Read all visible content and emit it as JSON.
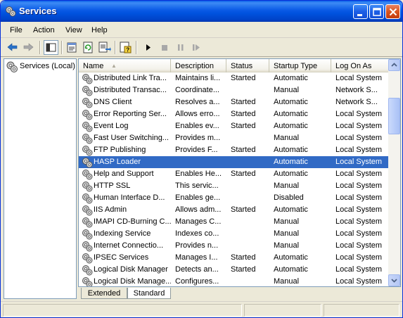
{
  "window": {
    "title": "Services",
    "buttons": [
      "minimize",
      "maximize",
      "close"
    ]
  },
  "menu": {
    "items": [
      "File",
      "Action",
      "View",
      "Help"
    ]
  },
  "toolbar": {
    "icons": [
      "back-arrow-icon",
      "forward-arrow-icon",
      "show-hide-tree-icon",
      "properties-icon",
      "refresh-icon",
      "export-list-icon",
      "help-icon",
      "start-service-icon",
      "stop-service-icon",
      "pause-service-icon",
      "restart-service-icon"
    ]
  },
  "tree": {
    "root_label": "Services (Local)"
  },
  "list": {
    "columns": [
      "Name",
      "Description",
      "Status",
      "Startup Type",
      "Log On As"
    ],
    "sorted_column": "Name",
    "selected_row": "HASP Loader",
    "rows": [
      {
        "name": "Distributed Link Tra...",
        "description": "Maintains li...",
        "status": "Started",
        "startup": "Automatic",
        "logon": "Local System"
      },
      {
        "name": "Distributed Transac...",
        "description": "Coordinate...",
        "status": "",
        "startup": "Manual",
        "logon": "Network S..."
      },
      {
        "name": "DNS Client",
        "description": "Resolves a...",
        "status": "Started",
        "startup": "Automatic",
        "logon": "Network S..."
      },
      {
        "name": "Error Reporting Ser...",
        "description": "Allows erro...",
        "status": "Started",
        "startup": "Automatic",
        "logon": "Local System"
      },
      {
        "name": "Event Log",
        "description": "Enables ev...",
        "status": "Started",
        "startup": "Automatic",
        "logon": "Local System"
      },
      {
        "name": "Fast User Switching...",
        "description": "Provides m...",
        "status": "",
        "startup": "Manual",
        "logon": "Local System"
      },
      {
        "name": "FTP Publishing",
        "description": "Provides F...",
        "status": "Started",
        "startup": "Automatic",
        "logon": "Local System"
      },
      {
        "name": "HASP Loader",
        "description": "",
        "status": "",
        "startup": "Automatic",
        "logon": "Local System"
      },
      {
        "name": "Help and Support",
        "description": "Enables He...",
        "status": "Started",
        "startup": "Automatic",
        "logon": "Local System"
      },
      {
        "name": "HTTP SSL",
        "description": "This servic...",
        "status": "",
        "startup": "Manual",
        "logon": "Local System"
      },
      {
        "name": "Human Interface D...",
        "description": "Enables ge...",
        "status": "",
        "startup": "Disabled",
        "logon": "Local System"
      },
      {
        "name": "IIS Admin",
        "description": "Allows adm...",
        "status": "Started",
        "startup": "Automatic",
        "logon": "Local System"
      },
      {
        "name": "IMAPI CD-Burning C...",
        "description": "Manages C...",
        "status": "",
        "startup": "Manual",
        "logon": "Local System"
      },
      {
        "name": "Indexing Service",
        "description": "Indexes co...",
        "status": "",
        "startup": "Manual",
        "logon": "Local System"
      },
      {
        "name": "Internet Connectio...",
        "description": "Provides n...",
        "status": "",
        "startup": "Manual",
        "logon": "Local System"
      },
      {
        "name": "IPSEC Services",
        "description": "Manages I...",
        "status": "Started",
        "startup": "Automatic",
        "logon": "Local System"
      },
      {
        "name": "Logical Disk Manager",
        "description": "Detects an...",
        "status": "Started",
        "startup": "Automatic",
        "logon": "Local System"
      },
      {
        "name": "Logical Disk Manage...",
        "description": "Configures...",
        "status": "",
        "startup": "Manual",
        "logon": "Local System"
      }
    ]
  },
  "tabs": {
    "extended": "Extended",
    "standard": "Standard",
    "active": "Standard"
  },
  "colors": {
    "selection": "#316ac5",
    "titlebar": "#0a5ae6",
    "accent": "#0831d9"
  }
}
